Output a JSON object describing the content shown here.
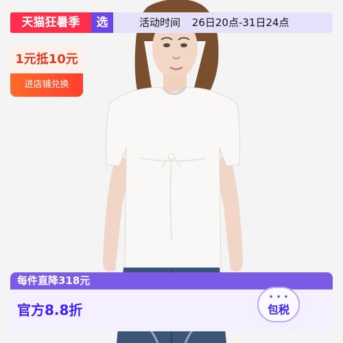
{
  "promo_header": {
    "tmall_label": "天猫狂暑季",
    "select_label": "选",
    "event_label": "活动时间",
    "event_time": "26日20点-31日24点"
  },
  "coupon": {
    "amount_text": "1元抵10元",
    "action_text": "进店铺兑换"
  },
  "bottom_banner": {
    "discount_text": "每件直降318元",
    "main_text": "官方8.8折",
    "tax_badge": "包税",
    "badge_dots": "• • •"
  },
  "colors": {
    "tmall_red": "#ff2f4b",
    "select_purple": "#6d46e6",
    "banner_purple": "#7c5ae8",
    "main_blue": "#3f22ff",
    "coupon_orange": "#ff4a2d"
  },
  "icons": {
    "product_photo": "woman-in-white-tshirt-photo"
  }
}
